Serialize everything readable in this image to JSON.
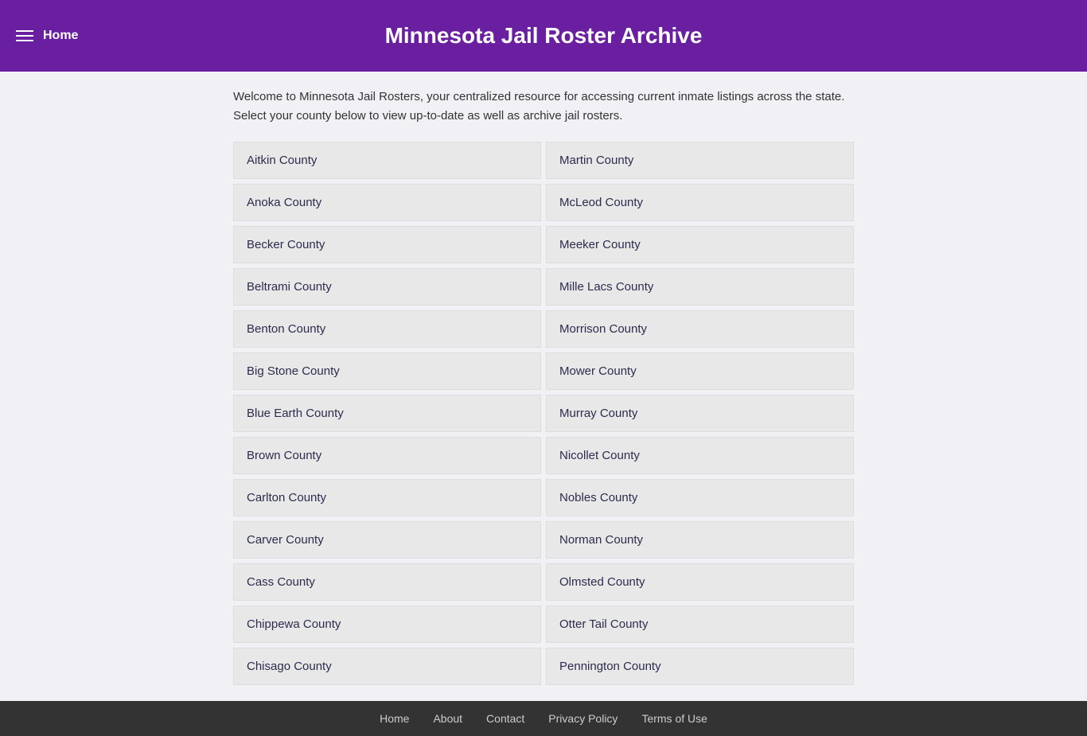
{
  "header": {
    "home_label": "Home",
    "title": "Minnesota Jail Roster Archive"
  },
  "main": {
    "welcome": "Welcome to Minnesota Jail Rosters, your centralized resource for accessing current inmate listings across the state. Select your county below to view up-to-date as well as archive jail rosters.",
    "counties_left": [
      "Aitkin County",
      "Anoka County",
      "Becker County",
      "Beltrami County",
      "Benton County",
      "Big Stone County",
      "Blue Earth County",
      "Brown County",
      "Carlton County",
      "Carver County",
      "Cass County",
      "Chippewa County",
      "Chisago County"
    ],
    "counties_right": [
      "Martin County",
      "McLeod County",
      "Meeker County",
      "Mille Lacs County",
      "Morrison County",
      "Mower County",
      "Murray County",
      "Nicollet County",
      "Nobles County",
      "Norman County",
      "Olmsted County",
      "Otter Tail County",
      "Pennington County"
    ]
  },
  "footer": {
    "links": [
      "Home",
      "About",
      "Contact",
      "Privacy Policy",
      "Terms of Use"
    ]
  }
}
